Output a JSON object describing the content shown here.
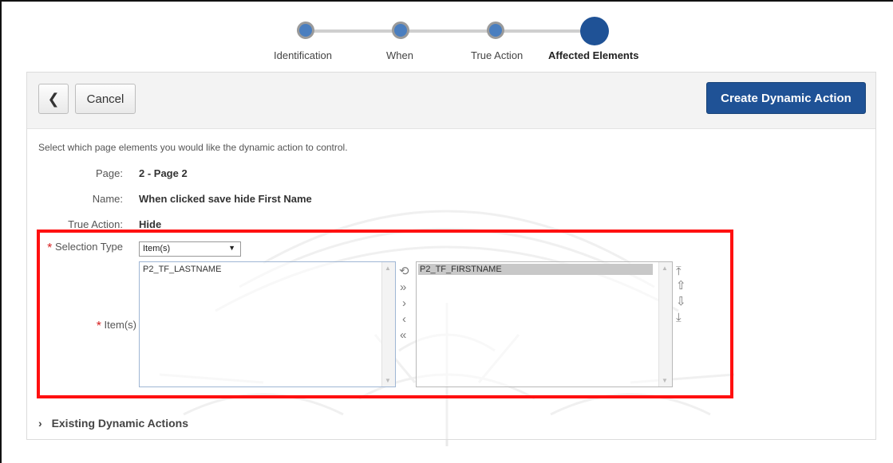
{
  "wizard": {
    "steps": [
      {
        "label": "Identification",
        "current": false
      },
      {
        "label": "When",
        "current": false
      },
      {
        "label": "True Action",
        "current": false
      },
      {
        "label": "Affected Elements",
        "current": true
      }
    ]
  },
  "toolbar": {
    "back_icon": "chevron-left-icon",
    "back_glyph": "❮",
    "cancel_label": "Cancel",
    "create_label": "Create Dynamic Action",
    "create_color": "#1f5296"
  },
  "form": {
    "intro": "Select which page elements you would like the dynamic action to control.",
    "page_label": "Page:",
    "page_value": "2 - Page 2",
    "name_label": "Name:",
    "name_value": "When clicked save hide First Name",
    "true_action_label": "True Action:",
    "true_action_value": "Hide",
    "required_marker": "*",
    "selection_type_label": "Selection Type",
    "selection_type_value": "Item(s)",
    "items_label": "Item(s)",
    "available_items": [
      "P2_TF_LASTNAME"
    ],
    "selected_items": [
      "P2_TF_FIRSTNAME"
    ]
  },
  "shuttle": {
    "reset_glyph": "⟲",
    "move_all_glyph": "»",
    "move_glyph": "›",
    "remove_glyph": "‹",
    "remove_all_glyph": "«",
    "top_glyph": "⤒",
    "up_glyph": "⇧",
    "down_glyph": "⇩",
    "bottom_glyph": "⤓"
  },
  "existing": {
    "chevron": "›",
    "label": "Existing Dynamic Actions"
  },
  "colors": {
    "accent": "#1f5296",
    "highlight": "#ff1010",
    "required": "#d61f1f"
  }
}
